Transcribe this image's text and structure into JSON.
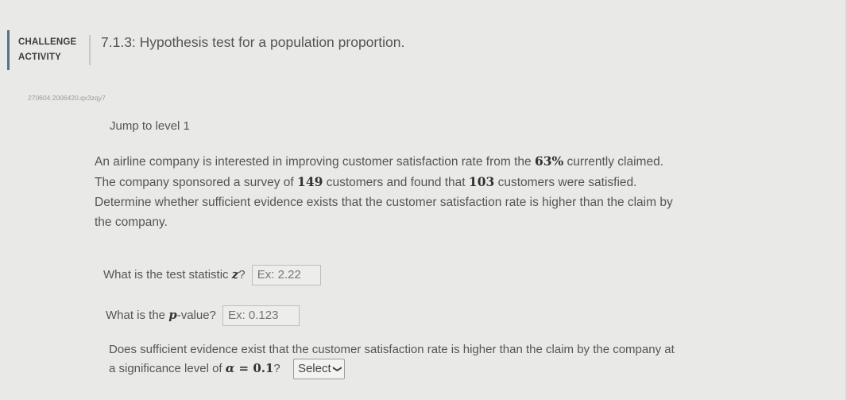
{
  "header": {
    "challenge_line1": "CHALLENGE",
    "challenge_line2": "ACTIVITY",
    "title": "7.1.3: Hypothesis test for a population proportion.",
    "activity_id": "270604.2006420.qx3zqy7"
  },
  "jump": {
    "label": "Jump to level 1"
  },
  "question": {
    "l1_a": "An airline company is interested in improving customer satisfaction rate from the ",
    "l1_pct": "63%",
    "l1_b": " currently claimed.",
    "l2_a": "The company sponsored a survey of ",
    "l2_n": "149",
    "l2_b": " customers and found that ",
    "l2_k": "103",
    "l2_c": " customers were satisfied.",
    "l3": "Determine whether sufficient evidence exists that the customer satisfaction rate is higher than the claim by",
    "l4": "the company."
  },
  "test_statistic": {
    "label_a": "What is the test statistic ",
    "symbol": "z",
    "label_b": "?",
    "placeholder": "Ex: 2.22"
  },
  "p_value": {
    "label_a": "What is the ",
    "symbol": "p",
    "label_b": "-value?",
    "placeholder": "Ex: 0.123"
  },
  "evidence": {
    "line1": "Does sufficient evidence exist that the customer satisfaction rate is higher than the claim by the company at",
    "line2_a": "a significance level of ",
    "alpha": "α",
    "equals": " = ",
    "alpha_value": "0.1",
    "line2_b": "?",
    "select_label": "Select"
  },
  "icons": {
    "select_chevron": "chevron-down-icon"
  }
}
